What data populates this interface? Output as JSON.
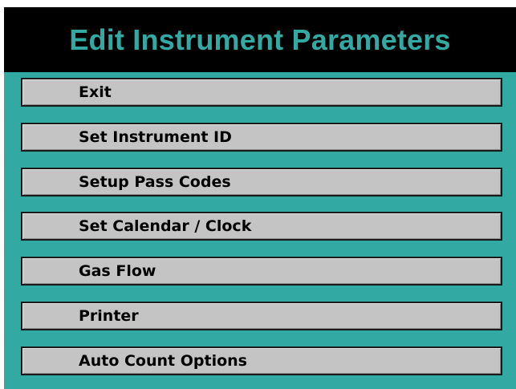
{
  "screen": {
    "title": "Edit Instrument Parameters"
  },
  "menu": {
    "items": [
      {
        "label": "Exit"
      },
      {
        "label": "Set Instrument ID"
      },
      {
        "label": "Setup Pass Codes"
      },
      {
        "label": "Set Calendar / Clock"
      },
      {
        "label": "Gas Flow"
      },
      {
        "label": "Printer"
      },
      {
        "label": "Auto Count Options"
      }
    ]
  },
  "colors": {
    "panel_background": "#33a9a3",
    "title_background": "#000000",
    "title_text": "#33a9a3",
    "button_face": "#c4c4c4",
    "button_border": "#1a1a1a",
    "button_text": "#000000"
  }
}
